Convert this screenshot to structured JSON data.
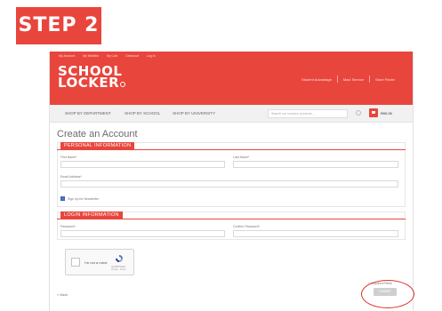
{
  "step_badge": "STEP 2",
  "top_links": [
    "My Account",
    "My Wishlist",
    "My Cart",
    "Checkout",
    "Log In"
  ],
  "logo": {
    "line1": "SCHOOL",
    "line2": "LOCKER"
  },
  "header_links": [
    "Student Advantage",
    "Mac! Service",
    "Store Finder"
  ],
  "nav": {
    "items": [
      "SHOP BY DEPARTMENT",
      "SHOP BY SCHOOL",
      "SHOP BY UNIVERSITY"
    ],
    "search_placeholder": "Search our courses, products ...",
    "cart_total": "R00.00"
  },
  "page_title": "Create an Account",
  "personal_info": {
    "heading": "PERSONAL INFORMATION",
    "first_name_label": "First Name*",
    "last_name_label": "Last Name*",
    "email_label": "Email Address*",
    "newsletter_label": "Sign Up for Newsletter",
    "newsletter_checked": true
  },
  "login_info": {
    "heading": "LOGIN INFORMATION",
    "password_label": "Password*",
    "confirm_password_label": "Confirm Password*"
  },
  "captcha": {
    "label": "I'm not a robot",
    "brand": "reCAPTCHA",
    "terms": "Privacy - Terms"
  },
  "back_link": "« Back",
  "required_note": "* Required Fields",
  "submit_label": "SUBMIT",
  "colors": {
    "brand_red": "#e8453c",
    "highlight_red": "#d9322a",
    "checkbox_blue": "#4a78c4"
  }
}
